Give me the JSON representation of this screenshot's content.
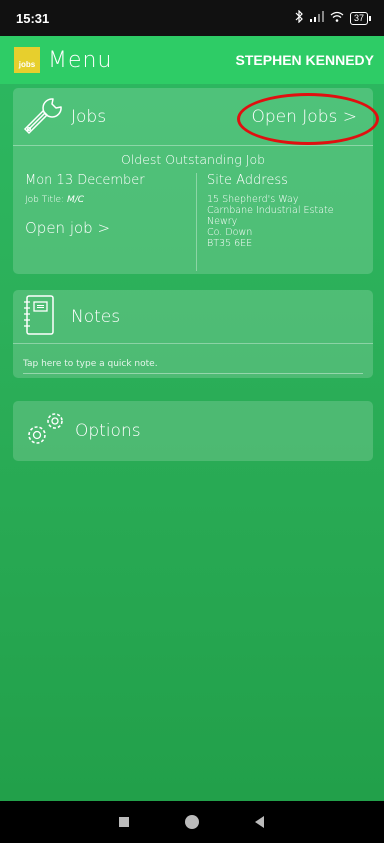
{
  "status_bar": {
    "time": "15:31",
    "battery": "37",
    "icons": [
      "bluetooth-icon",
      "signal-icon",
      "wifi-icon",
      "battery-icon"
    ]
  },
  "header": {
    "logo_text": "jobs",
    "title": "Menu",
    "user_name": "STEPHEN KENNEDY",
    "bar_color": "#2ecc66",
    "logo_color": "#e7cf2d"
  },
  "jobs_card": {
    "title": "Jobs",
    "open_jobs_label": "Open Jobs >",
    "oldest_label": "Oldest Outstanding Job",
    "job": {
      "date": "Mon 13 December",
      "title_label": "Job Title:",
      "title_value": "M/C",
      "open_job_label": "Open job >",
      "site_address_heading": "Site Address",
      "address_lines": [
        "15 Shepherd's Way",
        "Carnbane Industrial Estate",
        "Newry",
        "Co. Down",
        "BT35 6EE"
      ]
    },
    "highlight_color": "#e01010"
  },
  "notes_card": {
    "title": "Notes",
    "placeholder": "Tap here to type a quick note."
  },
  "options_card": {
    "title": "Options"
  },
  "nav_bar": {
    "buttons": [
      "recent-apps-button",
      "home-button",
      "back-button"
    ]
  }
}
